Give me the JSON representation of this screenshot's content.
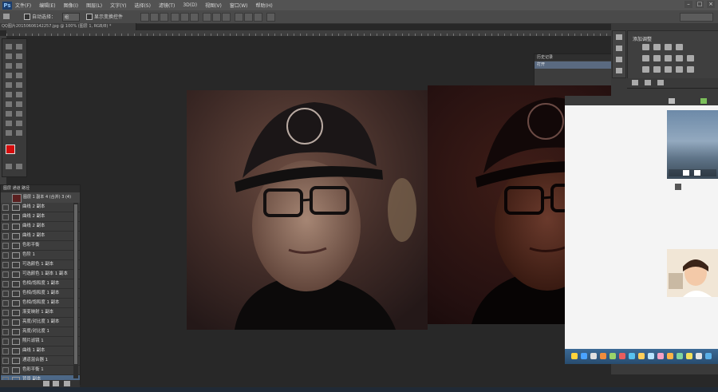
{
  "app": {
    "logo": "Ps",
    "menu": [
      "文件(F)",
      "编辑(E)",
      "图像(I)",
      "图层(L)",
      "文字(Y)",
      "选择(S)",
      "滤镜(T)",
      "3D(D)",
      "视图(V)",
      "窗口(W)",
      "帮助(H)"
    ],
    "window_controls": [
      "–",
      "□",
      "×"
    ]
  },
  "options_bar": {
    "auto_select_label": "自动选择：",
    "transform_label": "显示变换控件",
    "group_label": "组"
  },
  "document": {
    "tab_title": "QQ图片20150606142257.jpg @ 100% (图层 1, RGB/8) *"
  },
  "history_panel": {
    "header": "历史记录",
    "row": "打开"
  },
  "adjustments_panel": {
    "title": "添加调整"
  },
  "layers_panel": {
    "header": "图层 通道 路径",
    "top_layer": "图层 1 副本 4 (合并) 3 (4)",
    "layers": [
      {
        "name": "曲线 2 副本",
        "selected": false
      },
      {
        "name": "曲线 2 副本",
        "selected": false
      },
      {
        "name": "曲线 2 副本",
        "selected": false
      },
      {
        "name": "曲线 2 副本",
        "selected": false
      },
      {
        "name": "色彩平衡",
        "selected": false
      },
      {
        "name": "色阶 1",
        "selected": false
      },
      {
        "name": "可选颜色 1 副本",
        "selected": false
      },
      {
        "name": "可选颜色 1 副本 1 副本",
        "selected": false
      },
      {
        "name": "色相/饱和度 1 副本",
        "selected": false
      },
      {
        "name": "色相/饱和度 1 副本",
        "selected": false
      },
      {
        "name": "色相/饱和度 1 副本",
        "selected": false
      },
      {
        "name": "渐变映射 1 副本",
        "selected": false
      },
      {
        "name": "亮度/对比度 1 副本",
        "selected": false
      },
      {
        "name": "亮度/对比度 1",
        "selected": false
      },
      {
        "name": "照片滤镜 1",
        "selected": false
      },
      {
        "name": "曲线 1 副本",
        "selected": false
      },
      {
        "name": "通道混合器 1",
        "selected": false
      },
      {
        "name": "色彩平衡 1",
        "selected": false
      },
      {
        "name": "背景 副本",
        "selected": true
      }
    ]
  },
  "photos": {
    "left_alt": "edited portrait",
    "right_alt": "original portrait",
    "close": "×"
  },
  "colors": {
    "foreground": "#d40c0c",
    "background": "#ffffff",
    "ps_panel": "#3c3c3c",
    "selection": "#4d6887"
  }
}
